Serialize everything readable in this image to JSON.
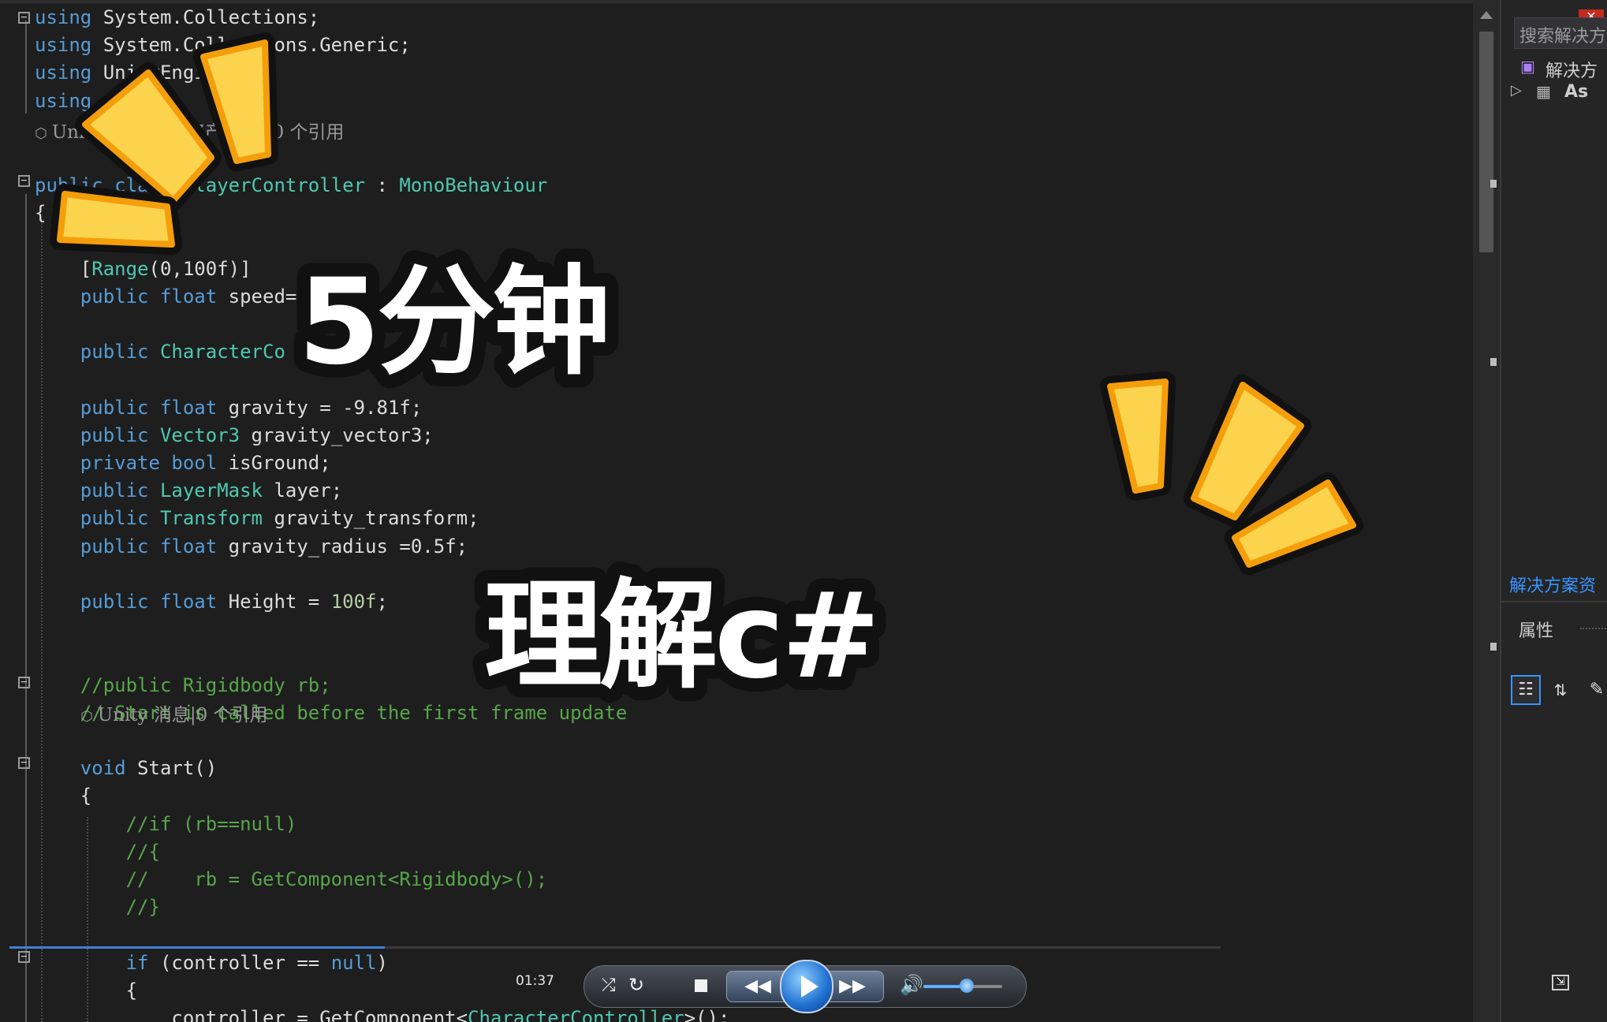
{
  "editor": {
    "lines": [
      [
        {
          "t": "using",
          "c": "kw"
        },
        {
          "t": " System.Collections;"
        }
      ],
      [
        {
          "t": "using",
          "c": "kw"
        },
        {
          "t": " System.Collections.Generic;"
        }
      ],
      [
        {
          "t": "using",
          "c": "kw"
        },
        {
          "t": " UnityEngine;"
        }
      ],
      [
        {
          "t": "using",
          "c": "kw"
        },
        {
          "t": " "
        }
      ],
      [],
      [
        {
          "t": "public",
          "c": "kw"
        },
        {
          "t": " "
        },
        {
          "t": "class",
          "c": "kw"
        },
        {
          "t": " "
        },
        {
          "t": "PlayerController",
          "c": "ty"
        },
        {
          "t": " : "
        },
        {
          "t": "MonoBehaviour",
          "c": "ty"
        }
      ],
      [
        {
          "t": "{"
        }
      ],
      [],
      [
        {
          "t": "    ["
        },
        {
          "t": "Range",
          "c": "ty"
        },
        {
          "t": "(0,100f)]"
        }
      ],
      [
        {
          "t": "    "
        },
        {
          "t": "public",
          "c": "kw"
        },
        {
          "t": " "
        },
        {
          "t": "float",
          "c": "kw"
        },
        {
          "t": " speed="
        }
      ],
      [],
      [
        {
          "t": "    "
        },
        {
          "t": "public",
          "c": "kw"
        },
        {
          "t": " "
        },
        {
          "t": "CharacterCo",
          "c": "ty"
        }
      ],
      [],
      [
        {
          "t": "    "
        },
        {
          "t": "public",
          "c": "kw"
        },
        {
          "t": " "
        },
        {
          "t": "float",
          "c": "kw"
        },
        {
          "t": " gravity = -9.81f;"
        }
      ],
      [
        {
          "t": "    "
        },
        {
          "t": "public",
          "c": "kw"
        },
        {
          "t": " "
        },
        {
          "t": "Vector3",
          "c": "ty"
        },
        {
          "t": " gravity_vector3;"
        }
      ],
      [
        {
          "t": "    "
        },
        {
          "t": "private",
          "c": "kw"
        },
        {
          "t": " "
        },
        {
          "t": "bool",
          "c": "kw"
        },
        {
          "t": " isGround;"
        }
      ],
      [
        {
          "t": "    "
        },
        {
          "t": "public",
          "c": "kw"
        },
        {
          "t": " "
        },
        {
          "t": "LayerMask",
          "c": "ty"
        },
        {
          "t": " layer;"
        }
      ],
      [
        {
          "t": "    "
        },
        {
          "t": "public",
          "c": "kw"
        },
        {
          "t": " "
        },
        {
          "t": "Transform",
          "c": "ty"
        },
        {
          "t": " gravity_transform;"
        }
      ],
      [
        {
          "t": "    "
        },
        {
          "t": "public",
          "c": "kw"
        },
        {
          "t": " "
        },
        {
          "t": "float",
          "c": "kw"
        },
        {
          "t": " gravity_radius =0.5f;"
        }
      ],
      [],
      [
        {
          "t": "    "
        },
        {
          "t": "public",
          "c": "kw"
        },
        {
          "t": " "
        },
        {
          "t": "float",
          "c": "kw"
        },
        {
          "t": " Height = "
        },
        {
          "t": "100f",
          "c": "num"
        },
        {
          "t": ";"
        }
      ],
      [],
      [],
      [
        {
          "t": "    //public Rigidbody rb;",
          "c": "cm"
        }
      ],
      [
        {
          "t": "    // Start is called before the first frame update",
          "c": "cm"
        }
      ],
      [],
      [
        {
          "t": "    "
        },
        {
          "t": "void",
          "c": "kw"
        },
        {
          "t": " Start()"
        }
      ],
      [
        {
          "t": "    {"
        }
      ],
      [
        {
          "t": "        //if (rb==null)",
          "c": "cm"
        }
      ],
      [
        {
          "t": "        //{",
          "c": "cm"
        }
      ],
      [
        {
          "t": "        //    rb = GetComponent<Rigidbody>();",
          "c": "cm"
        }
      ],
      [
        {
          "t": "        //}",
          "c": "cm"
        }
      ],
      [],
      [
        {
          "t": "        "
        },
        {
          "t": "if",
          "c": "kw"
        },
        {
          "t": " (controller == "
        },
        {
          "t": "null",
          "c": "kw"
        },
        {
          "t": ")"
        }
      ],
      [
        {
          "t": "        {"
        }
      ],
      [
        {
          "t": "            controller = GetComponent<"
        },
        {
          "t": "CharacterController",
          "c": "ty"
        },
        {
          "t": ">();"
        }
      ]
    ],
    "codelens": [
      {
        "line": 5,
        "text": "Unity 脚本(1 个资产引用)|0 个引用"
      },
      {
        "line": 26,
        "text": "Unity 消息|0 个引用"
      }
    ]
  },
  "overlay": {
    "title_line1": "5分钟",
    "title_line2": "理解c#"
  },
  "solution_explorer": {
    "search_placeholder": "搜索解决方",
    "solution_item": "解决方",
    "project_item": "As",
    "solution_tab": "解决方案资",
    "properties_title": "属性"
  },
  "media": {
    "time": "01:37",
    "progress": 0.31,
    "volume": 0.55
  },
  "colors": {
    "keyword": "#569cd6",
    "type": "#4ec9b0",
    "comment": "#57a64a",
    "burst_fill": "#fcd34d",
    "burst_stroke": "#f59e0b"
  }
}
